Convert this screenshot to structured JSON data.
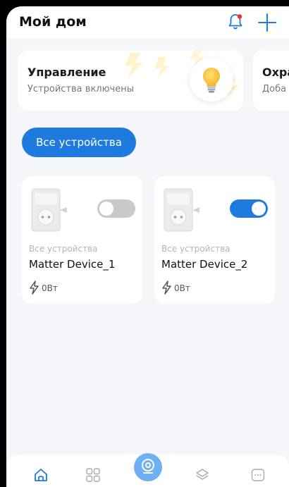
{
  "header": {
    "title": "Мой дом"
  },
  "summary_cards": [
    {
      "title": "Управление",
      "subtitle": "Устройства включены"
    },
    {
      "title": "Охра",
      "subtitle": "Доба"
    }
  ],
  "filter": {
    "label": "Все устройства"
  },
  "devices": [
    {
      "category": "Все устройства",
      "name": "Matter Device_1",
      "power": "0Вт",
      "state": "off"
    },
    {
      "category": "Все устройства",
      "name": "Matter Device_2",
      "power": "0Вт",
      "state": "on"
    }
  ],
  "colors": {
    "accent": "#1f7ae0",
    "background": "#f4f6f9",
    "toggle_off": "#c9c9c9",
    "bell_dot": "#e5322d"
  },
  "tabs": [
    "home-icon",
    "grid-icon",
    "camera-icon",
    "layers-icon",
    "message-icon"
  ]
}
